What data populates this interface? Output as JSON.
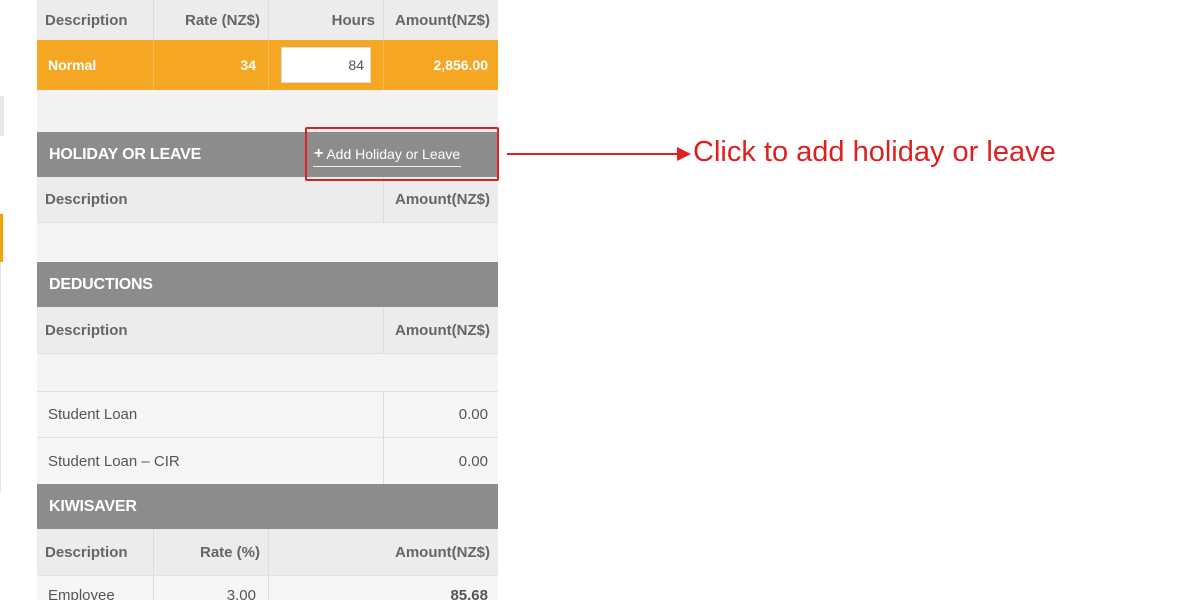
{
  "earnings": {
    "headers": {
      "description": "Description",
      "rate": "Rate (NZ$)",
      "hours": "Hours",
      "amount": "Amount(NZ$)"
    },
    "row": {
      "description": "Normal",
      "rate": "34",
      "hours": "84",
      "amount": "2,856.00"
    }
  },
  "holiday": {
    "title": "HOLIDAY OR LEAVE",
    "add_label": "Add Holiday or Leave",
    "headers": {
      "description": "Description",
      "amount": "Amount(NZ$)"
    }
  },
  "deductions": {
    "title": "DEDUCTIONS",
    "headers": {
      "description": "Description",
      "amount": "Amount(NZ$)"
    },
    "rows": [
      {
        "description": "Student Loan",
        "amount": "0.00"
      },
      {
        "description": "Student Loan – CIR",
        "amount": "0.00"
      }
    ]
  },
  "kiwisaver": {
    "title": "KIWISAVER",
    "headers": {
      "description": "Description",
      "rate": "Rate (%)",
      "amount": "Amount(NZ$)"
    },
    "rows": [
      {
        "description": "Employee",
        "rate": "3.00",
        "amount": "85.68"
      }
    ]
  },
  "annotation": {
    "text": "Click to add holiday or leave"
  },
  "colors": {
    "accent": "#f5a623",
    "section": "#8c8c8c",
    "annotation": "#e02020"
  }
}
